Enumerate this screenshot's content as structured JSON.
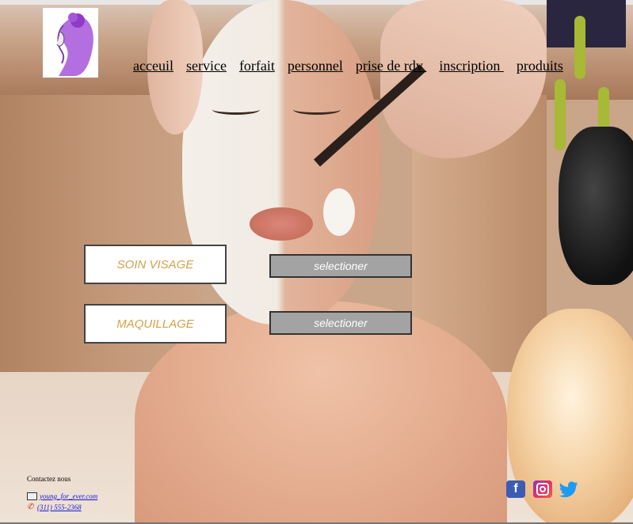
{
  "nav": {
    "items": [
      "acceuil",
      "service",
      "forfait",
      "personnel",
      "prise de rdv ",
      "inscription ",
      "produits"
    ]
  },
  "services": [
    {
      "name": "SOIN VISAGE",
      "button": "selectioner"
    },
    {
      "name": "MAQUILLAGE",
      "button": "selectioner"
    }
  ],
  "contact": {
    "title": "Contactez nous",
    "email": "young_for_ever.com",
    "phone": "(311) 555-2368"
  },
  "social": {
    "icons": [
      "facebook-icon",
      "instagram-icon",
      "twitter-icon"
    ]
  },
  "colors": {
    "service_text": "#d2a24a",
    "select_button": "#a3a3a3",
    "link": "#1a1ad6"
  }
}
